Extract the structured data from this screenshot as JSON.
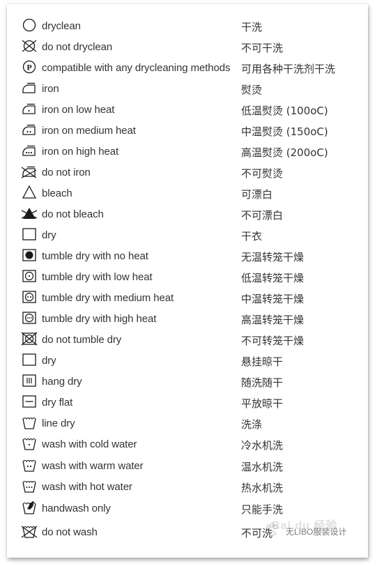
{
  "rows": [
    {
      "icon": "drycleaning-circle-icon",
      "en": "dryclean",
      "zh": "干洗"
    },
    {
      "icon": "do-not-dryclean-icon",
      "en": "do not dryclean",
      "zh": "不可干洗"
    },
    {
      "icon": "dryclean-p-icon",
      "en": "compatible with any drycleaning methods",
      "zh": "可用各种干洗剂干洗"
    },
    {
      "icon": "iron-icon",
      "en": "iron",
      "zh": "熨烫"
    },
    {
      "icon": "iron-low-heat-icon",
      "en": "iron on low heat",
      "zh": "低温熨烫 (100oC)"
    },
    {
      "icon": "iron-medium-heat-icon",
      "en": "iron on medium heat",
      "zh": "中温熨烫 (150oC)"
    },
    {
      "icon": "iron-high-heat-icon",
      "en": "iron on high heat",
      "zh": "高温熨烫 (200oC)"
    },
    {
      "icon": "do-not-iron-icon",
      "en": "do not iron",
      "zh": "不可熨烫"
    },
    {
      "icon": "bleach-triangle-icon",
      "en": "bleach",
      "zh": "可漂白"
    },
    {
      "icon": "do-not-bleach-icon",
      "en": "do not bleach",
      "zh": "不可漂白"
    },
    {
      "icon": "dry-square-icon",
      "en": "dry",
      "zh": "干衣"
    },
    {
      "icon": "tumble-dry-no-heat-icon",
      "en": "tumble dry with no heat",
      "zh": "无温转笼干燥"
    },
    {
      "icon": "tumble-dry-low-heat-icon",
      "en": "tumble dry with low heat",
      "zh": "低温转笼干燥"
    },
    {
      "icon": "tumble-dry-medium-heat-icon",
      "en": "tumble dry with medium heat",
      "zh": "中温转笼干燥"
    },
    {
      "icon": "tumble-dry-high-heat-icon",
      "en": "tumble dry with high heat",
      "zh": "高温转笼干燥"
    },
    {
      "icon": "do-not-tumble-dry-icon",
      "en": "do not tumble dry",
      "zh": "不可转笼干燥"
    },
    {
      "icon": "dry-square-icon",
      "en": "dry",
      "zh": "悬挂晾干"
    },
    {
      "icon": "hang-dry-icon",
      "en": "hang dry",
      "zh": "随洗随干"
    },
    {
      "icon": "dry-flat-icon",
      "en": "dry flat",
      "zh": "平放晾干"
    },
    {
      "icon": "wash-tub-icon",
      "en": "line dry",
      "zh": "洗涤"
    },
    {
      "icon": "wash-cold-icon",
      "en": "wash with cold water",
      "zh": "冷水机洗"
    },
    {
      "icon": "wash-warm-icon",
      "en": "wash with warm water",
      "zh": "温水机洗"
    },
    {
      "icon": "wash-hot-icon",
      "en": "wash with hot water",
      "zh": "热水机洗"
    },
    {
      "icon": "handwash-icon",
      "en": "handwash only",
      "zh": "只能手洗"
    },
    {
      "icon": "do-not-wash-icon",
      "en": "do not wash",
      "zh": "不可洗"
    }
  ],
  "watermark": {
    "logo": "Bai du 经验",
    "text": "无LIBO服装设计"
  }
}
